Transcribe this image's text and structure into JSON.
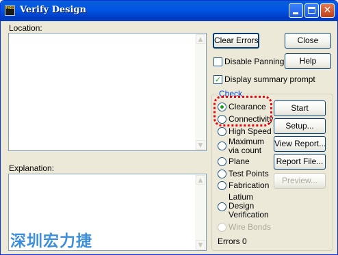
{
  "window": {
    "title": "Verify Design",
    "app_icon_text": "PADS"
  },
  "location": {
    "label": "Location:"
  },
  "explanation": {
    "label": "Explanation:"
  },
  "buttons": {
    "clear_errors": "Clear Errors",
    "close": "Close",
    "help": "Help",
    "start": "Start",
    "setup": "Setup...",
    "view_report": "View Report...",
    "report_file": "Report File...",
    "preview": "Preview..."
  },
  "options": {
    "disable_panning": {
      "label": "Disable Panning",
      "checked": false
    },
    "display_summary_prompt": {
      "label": "Display summary prompt",
      "checked": true
    }
  },
  "check": {
    "title": "Check",
    "items": [
      {
        "label": "Clearance",
        "selected": true,
        "enabled": true
      },
      {
        "label": "Connectivity",
        "selected": false,
        "enabled": true
      },
      {
        "label": "High Speed",
        "selected": false,
        "enabled": true
      },
      {
        "label": "Maximum via count",
        "selected": false,
        "enabled": true
      },
      {
        "label": "Plane",
        "selected": false,
        "enabled": true
      },
      {
        "label": "Test Points",
        "selected": false,
        "enabled": true
      },
      {
        "label": "Fabrication",
        "selected": false,
        "enabled": true
      },
      {
        "label": "Latium Design Verification",
        "selected": false,
        "enabled": true
      },
      {
        "label": "Wire Bonds",
        "selected": false,
        "enabled": false
      }
    ]
  },
  "errors": {
    "label": "Errors",
    "count": "0"
  },
  "watermark": "深圳宏力捷",
  "colors": {
    "accent": "#0054e3",
    "highlight": "#e8000a",
    "check_title": "#0046d5"
  }
}
